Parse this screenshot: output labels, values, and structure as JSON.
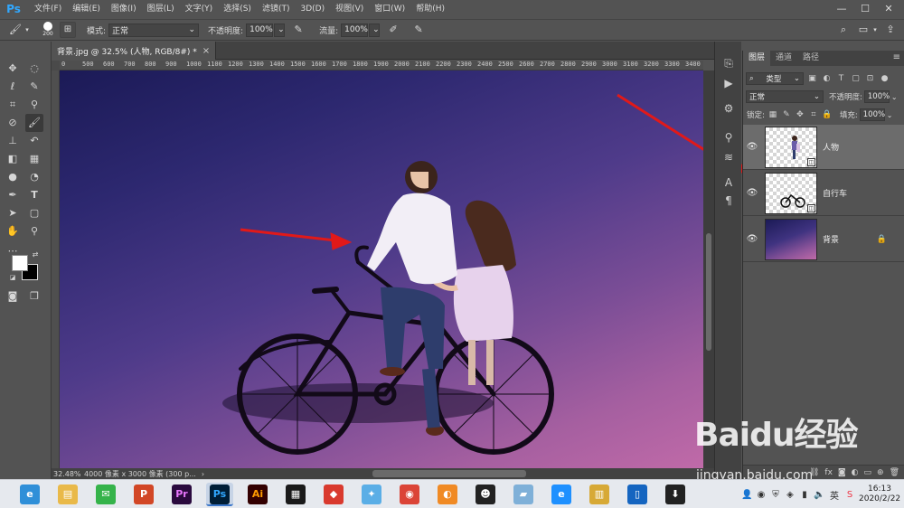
{
  "menu": {
    "logo": "Ps",
    "items": [
      "文件(F)",
      "编辑(E)",
      "图像(I)",
      "图层(L)",
      "文字(Y)",
      "选择(S)",
      "滤镜(T)",
      "3D(D)",
      "视图(V)",
      "窗口(W)",
      "帮助(H)"
    ],
    "window_controls": [
      "—",
      "☐",
      "✕"
    ]
  },
  "options": {
    "brush_size": "200",
    "mode_label": "模式:",
    "mode_value": "正常",
    "opacity_label": "不透明度:",
    "opacity_value": "100%",
    "flow_label": "流量:",
    "flow_value": "100%"
  },
  "document": {
    "tab_title": "背景.jpg @ 32.5% (人物, RGB/8#) *",
    "close": "×"
  },
  "ruler": {
    "ticks": [
      "0",
      "500",
      "600",
      "700",
      "800",
      "900",
      "1000",
      "1100",
      "1200",
      "1300",
      "1400",
      "1500",
      "1600",
      "1700",
      "1800",
      "1900",
      "2000",
      "2100",
      "2200",
      "2300",
      "2400",
      "2500",
      "2600",
      "2700",
      "2800",
      "2900",
      "3000",
      "3100",
      "3200",
      "3300",
      "3400"
    ]
  },
  "status": {
    "zoom": "32.48%",
    "doc_info": "4000 像素 x 3000 像素 (300 p...",
    "arrow": "›"
  },
  "layers_panel": {
    "tabs": [
      "图层",
      "通道",
      "路径"
    ],
    "filter_label": "类型",
    "blend_mode": "正常",
    "opacity_label": "不透明度:",
    "opacity_value": "100%",
    "lock_label": "锁定:",
    "fill_label": "填充:",
    "fill_value": "100%",
    "layers": [
      {
        "name": "人物",
        "selected": true
      },
      {
        "name": "自行车",
        "selected": false
      },
      {
        "name": "背景",
        "selected": false,
        "locked": true
      }
    ]
  },
  "watermark": {
    "brand": "Baidu经验",
    "url": "jingyan.baidu.com"
  },
  "taskbar": {
    "apps": [
      {
        "name": "browser",
        "glyph": "e",
        "color": "#2f8fd8"
      },
      {
        "name": "explorer",
        "glyph": "▤",
        "color": "#e9b949"
      },
      {
        "name": "wechat",
        "glyph": "✉",
        "color": "#35b34a"
      },
      {
        "name": "powerpoint",
        "glyph": "P",
        "color": "#d24726"
      },
      {
        "name": "premiere",
        "glyph": "Pr",
        "color": "#2a0a3e"
      },
      {
        "name": "photoshop",
        "glyph": "Ps",
        "color": "#001e36"
      },
      {
        "name": "illustrator",
        "glyph": "Ai",
        "color": "#330000"
      },
      {
        "name": "video-editor",
        "glyph": "▦",
        "color": "#1a1a1a"
      },
      {
        "name": "app-store",
        "glyph": "◆",
        "color": "#d93a2e"
      },
      {
        "name": "bird-app",
        "glyph": "✦",
        "color": "#5aaee6"
      },
      {
        "name": "chrome",
        "glyph": "◉",
        "color": "#db4437"
      },
      {
        "name": "player",
        "glyph": "◐",
        "color": "#f08a24"
      },
      {
        "name": "qq",
        "glyph": "☻",
        "color": "#222222"
      },
      {
        "name": "notes",
        "glyph": "▰",
        "color": "#7fb0d8"
      },
      {
        "name": "ie",
        "glyph": "e",
        "color": "#1e90ff"
      },
      {
        "name": "calendar",
        "glyph": "▥",
        "color": "#d7a936"
      },
      {
        "name": "tablet",
        "glyph": "▯",
        "color": "#1565c0"
      },
      {
        "name": "downloader",
        "glyph": "⬇",
        "color": "#222222"
      }
    ],
    "clock_time": "16:13",
    "clock_date": "2020/2/22",
    "ime": "英"
  }
}
